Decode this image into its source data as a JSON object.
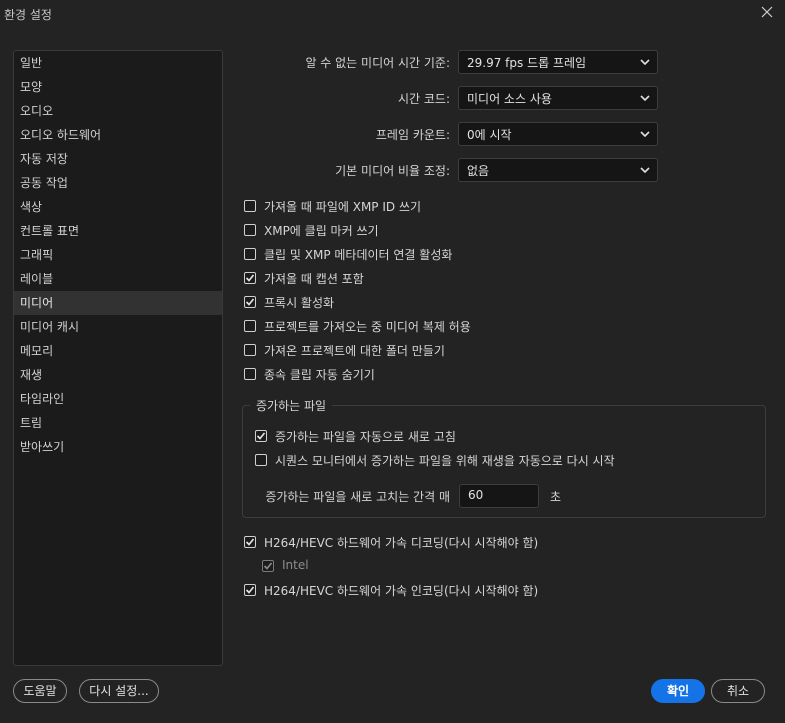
{
  "window": {
    "title": "환경 설정"
  },
  "sidebar": {
    "items": [
      {
        "label": "일반",
        "selected": false
      },
      {
        "label": "모양",
        "selected": false
      },
      {
        "label": "오디오",
        "selected": false
      },
      {
        "label": "오디오 하드웨어",
        "selected": false
      },
      {
        "label": "자동 저장",
        "selected": false
      },
      {
        "label": "공동 작업",
        "selected": false
      },
      {
        "label": "색상",
        "selected": false
      },
      {
        "label": "컨트롤 표면",
        "selected": false
      },
      {
        "label": "그래픽",
        "selected": false
      },
      {
        "label": "레이블",
        "selected": false
      },
      {
        "label": "미디어",
        "selected": true
      },
      {
        "label": "미디어 캐시",
        "selected": false
      },
      {
        "label": "메모리",
        "selected": false
      },
      {
        "label": "재생",
        "selected": false
      },
      {
        "label": "타임라인",
        "selected": false
      },
      {
        "label": "트림",
        "selected": false
      },
      {
        "label": "받아쓰기",
        "selected": false
      }
    ]
  },
  "settings": {
    "indeterminate_timebase": {
      "label": "알 수 없는 미디어 시간 기준:",
      "value": "29.97 fps 드롭 프레임"
    },
    "timecode": {
      "label": "시간 코드:",
      "value": "미디어 소스 사용"
    },
    "frame_count": {
      "label": "프레임 카운트:",
      "value": "0에 시작"
    },
    "default_scaling": {
      "label": "기본 미디어 비율 조정:",
      "value": "없음"
    }
  },
  "checkboxes": [
    {
      "label": "가져올 때 파일에 XMP ID 쓰기",
      "checked": false
    },
    {
      "label": "XMP에 클립 마커 쓰기",
      "checked": false
    },
    {
      "label": "클립 및 XMP 메타데이터 연결 활성화",
      "checked": false
    },
    {
      "label": "가져올 때 캡션 포함",
      "checked": true
    },
    {
      "label": "프록시 활성화",
      "checked": true
    },
    {
      "label": "프로젝트를 가져오는 중 미디어 복제 허용",
      "checked": false
    },
    {
      "label": "가져온 프로젝트에 대한 폴더 만들기",
      "checked": false
    },
    {
      "label": "종속 클립 자동 숨기기",
      "checked": false
    }
  ],
  "growing_files": {
    "title": "증가하는 파일",
    "refresh": {
      "label": "증가하는 파일을 자동으로 새로 고침",
      "checked": true
    },
    "restart": {
      "label": "시퀀스 모니터에서 증가하는 파일을 위해 재생을 자동으로 다시 시작",
      "checked": false
    },
    "interval_label": "증가하는 파일을 새로 고치는 간격 매",
    "interval_value": "60",
    "interval_unit": "초"
  },
  "hardware": {
    "decode": {
      "label": "H264/HEVC 하드웨어 가속 디코딩(다시 시작해야 함)",
      "checked": true
    },
    "intel": {
      "label": "Intel",
      "checked": true
    },
    "encode": {
      "label": "H264/HEVC 하드웨어 가속 인코딩(다시 시작해야 함)",
      "checked": true
    }
  },
  "buttons": {
    "help": "도움말",
    "reset": "다시 설정...",
    "ok": "확인",
    "cancel": "취소"
  },
  "colors": {
    "accent": "#1473e6",
    "background": "#232323",
    "panel": "#1b1b1b"
  }
}
